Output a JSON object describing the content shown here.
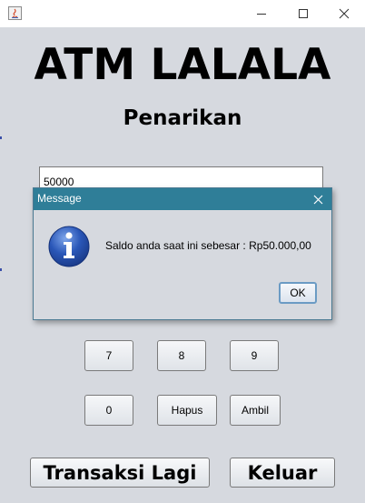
{
  "window": {
    "min_icon": "minimize-icon",
    "max_icon": "maximize-icon",
    "close_icon": "close-icon"
  },
  "main": {
    "title": "ATM LALALA",
    "subtitle": "Penarikan",
    "amount_value": "50000"
  },
  "keypad": {
    "k7": "7",
    "k8": "8",
    "k9": "9",
    "k0": "0",
    "hapus": "Hapus",
    "ambil": "Ambil"
  },
  "footer": {
    "transaksi_lagi": "Transaksi Lagi",
    "keluar": "Keluar"
  },
  "dialog": {
    "title": "Message",
    "message": "Saldo anda saat ini sebesar : Rp50.000,00",
    "ok": "OK",
    "icon": "info-icon"
  },
  "colors": {
    "dialog_titlebar": "#2f7e98",
    "window_bg": "#d6d9df",
    "info_icon_blue": "#2a57b8"
  }
}
